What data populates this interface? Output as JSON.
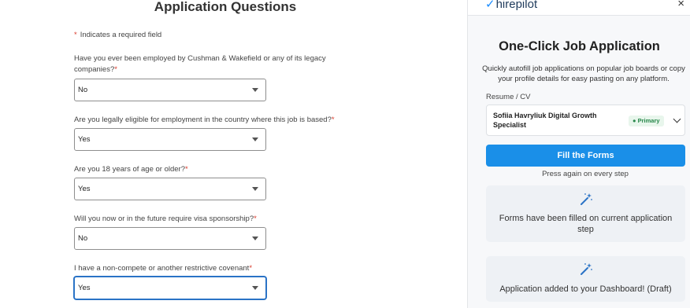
{
  "form": {
    "title": "Application Questions",
    "required_note": "Indicates a required field",
    "questions": [
      {
        "label": "Have you ever been employed by Cushman & Wakefield or any of its legacy companies?",
        "value": "No"
      },
      {
        "label": "Are you legally eligible for employment in the country where this job is based?",
        "value": "Yes"
      },
      {
        "label": "Are you 18 years of age or older?",
        "value": "Yes"
      },
      {
        "label": "Will you now or in the future require visa sponsorship?",
        "value": "No"
      },
      {
        "label": "I have a non-compete or another restrictive covenant",
        "value": "Yes"
      }
    ],
    "required_star": "*"
  },
  "panel": {
    "brand": "hirepilot",
    "close_glyph": "×",
    "title": "One-Click Job Application",
    "description": "Quickly autofill job applications on popular job boards or copy your profile details for easy pasting on any platform.",
    "resume_label": "Resume / CV",
    "resume_name": "Sofiia Havryliuk Digital Growth Specialist",
    "badge": "Primary",
    "fill_button": "Fill the Forms",
    "press_note": "Press again on every step",
    "cards": [
      {
        "text": "Forms have been filled on current application step"
      },
      {
        "text": "Application added to your Dashboard! (Draft)"
      }
    ],
    "colors": {
      "accent": "#1a8fe8",
      "badge_bg": "#e8f6ec",
      "badge_text": "#27874a",
      "required": "#d93a2b"
    },
    "icons": {
      "wand": "magic-wand-icon",
      "close": "close-icon"
    }
  }
}
